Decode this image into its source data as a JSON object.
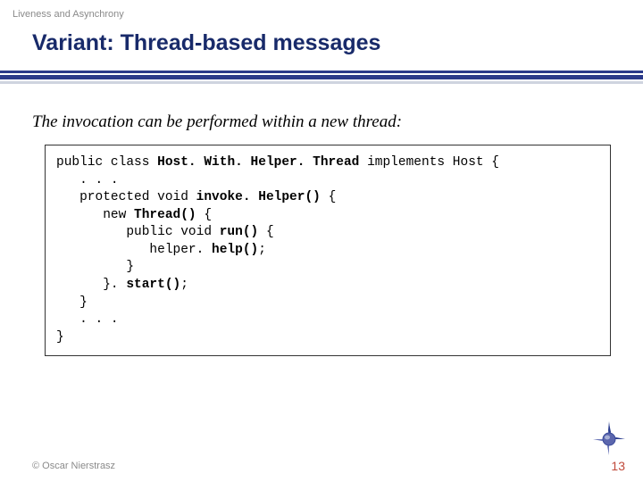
{
  "topic": "Liveness and Asynchrony",
  "title": "Variant: Thread-based messages",
  "body_text": "The invocation can be performed within a new thread:",
  "code": {
    "l1a": "public class ",
    "l1b": "Host. With. Helper. Thread",
    "l1c": " implements Host {",
    "l2": "   . . .",
    "l3a": "   protected void ",
    "l3b": "invoke. Helper()",
    "l3c": " {",
    "l4a": "      new ",
    "l4b": "Thread()",
    "l4c": " {",
    "l5a": "         public void ",
    "l5b": "run()",
    "l5c": " {",
    "l6a": "            helper. ",
    "l6b": "help()",
    "l6c": ";",
    "l7": "         }",
    "l8a": "      }. ",
    "l8b": "start()",
    "l8c": ";",
    "l9": "   }",
    "l10": "   . . .",
    "l11": "}"
  },
  "footer": "© Oscar Nierstrasz",
  "page_number": "13"
}
